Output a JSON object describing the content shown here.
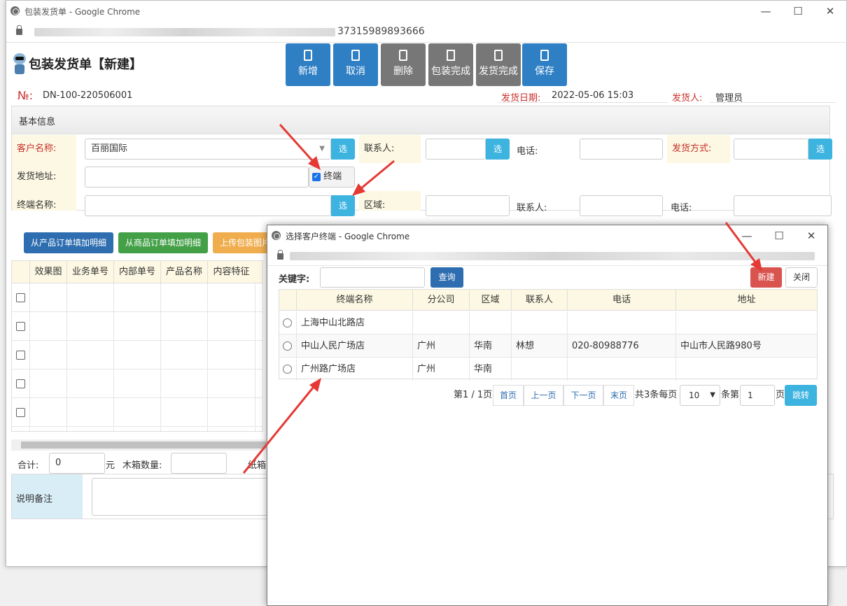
{
  "window": {
    "title": "包装发货单 - Google Chrome",
    "url_tail": "37315989893666"
  },
  "page": {
    "title": "包装发货单【新建】"
  },
  "toolbar": {
    "new": "新增",
    "cancel": "取消",
    "delete": "删除",
    "pack_done": "包装完成",
    "ship_done": "发货完成",
    "save": "保存"
  },
  "doc": {
    "no_label": "№:",
    "no_value": "DN-100-220506001",
    "date_label": "发货日期:",
    "date_value": "2022-05-06 15:03",
    "shipper_label": "发货人:",
    "shipper_value": "管理员"
  },
  "basic": {
    "header": "基本信息",
    "customer_label": "客户名称:",
    "customer_value": "百丽国际",
    "select_btn": "选",
    "contact_label": "联系人:",
    "phone_label": "电话:",
    "ship_method_label": "发货方式:",
    "address_label": "发货地址:",
    "terminal_checkbox": "终端",
    "terminal_label": "终端名称:",
    "region_label": "区域:",
    "contact2_label": "联系人:",
    "phone2_label": "电话:"
  },
  "detail": {
    "btn_from_product": "从产品订单填加明细",
    "btn_from_goods": "从商品订单填加明细",
    "btn_upload": "上传包装图片",
    "columns": [
      "效果图",
      "业务单号",
      "内部单号",
      "产品名称",
      "内容特征"
    ],
    "total_label": "合计:",
    "total_value": "0",
    "total_unit": "元",
    "wood_label": "木箱数量:",
    "carton_label": "纸箱",
    "remark_label": "说明备注"
  },
  "dialog": {
    "title": "选择客户终端 - Google Chrome",
    "keyword_label": "关键字:",
    "query_btn": "查询",
    "new_btn": "新建",
    "close_btn": "关闭",
    "columns": [
      "终端名称",
      "分公司",
      "区域",
      "联系人",
      "电话",
      "地址"
    ],
    "rows": [
      {
        "name": "上海中山北路店",
        "branch": "",
        "region": "",
        "contact": "",
        "phone": "",
        "address": ""
      },
      {
        "name": "中山人民广场店",
        "branch": "广州",
        "region": "华南",
        "contact": "林想",
        "phone": "020-80988776",
        "address": "中山市人民路980号"
      },
      {
        "name": "广州路广场店",
        "branch": "广州",
        "region": "华南",
        "contact": "",
        "phone": "",
        "address": ""
      }
    ],
    "pager": {
      "page_info": "第1 / 1页",
      "first": "首页",
      "prev": "上一页",
      "next": "下一页",
      "last": "末页",
      "total_info": "共3条每页",
      "per_page": "10",
      "goto_prefix": "条第",
      "goto_value": "1",
      "goto_suffix": "页",
      "jump": "跳转"
    }
  },
  "colors": {
    "accent": "#2e7fc4",
    "label_bg": "#fcf8e3",
    "required": "#c9302c",
    "arrow": "#e53935"
  }
}
